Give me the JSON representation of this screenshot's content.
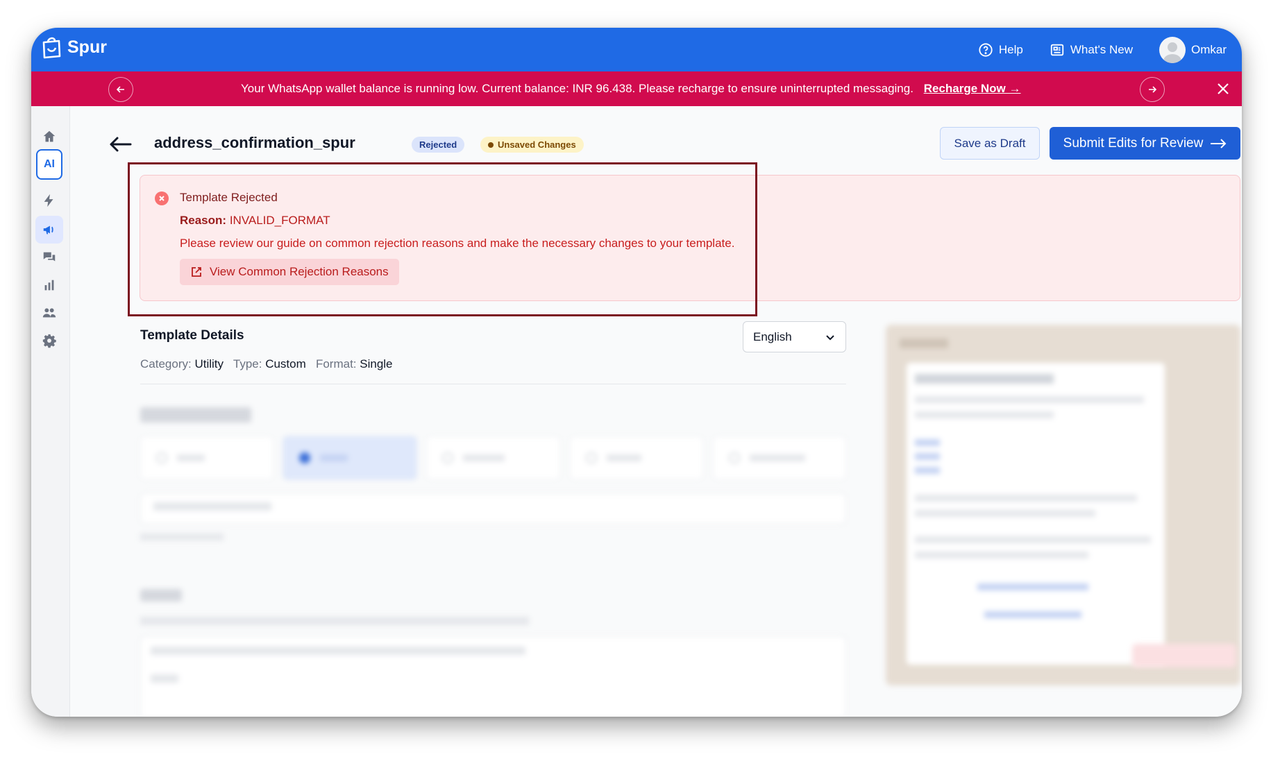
{
  "app": {
    "name": "Spur"
  },
  "topbar": {
    "help_label": "Help",
    "whats_new_label": "What's New",
    "user_name": "Omkar"
  },
  "banner": {
    "message": "Your WhatsApp wallet balance is running low. Current balance: INR 96.438. Please recharge to ensure uninterrupted messaging.",
    "link_label": "Recharge Now →"
  },
  "sidebar": {
    "items": [
      {
        "icon": "home-icon"
      },
      {
        "icon": "ai-icon",
        "label": "AI"
      },
      {
        "icon": "lightning-icon"
      },
      {
        "icon": "megaphone-icon"
      },
      {
        "icon": "chat-icon"
      },
      {
        "icon": "bar-chart-icon"
      },
      {
        "icon": "users-icon"
      },
      {
        "icon": "gear-icon"
      }
    ]
  },
  "header": {
    "title": "address_confirmation_spur",
    "status_badge": "Rejected",
    "unsaved_badge": "Unsaved Changes",
    "save_draft_label": "Save as Draft",
    "submit_label": "Submit Edits for Review"
  },
  "rejection": {
    "title": "Template Rejected",
    "reason_label": "Reason:",
    "reason_value": "INVALID_FORMAT",
    "description": "Please review our guide on common rejection reasons and make the necessary changes to your template.",
    "button_label": "View Common Rejection Reasons"
  },
  "details": {
    "title": "Template Details",
    "category_label": "Category:",
    "category_value": "Utility",
    "type_label": "Type:",
    "type_value": "Custom",
    "format_label": "Format:",
    "format_value": "Single",
    "language": "English"
  },
  "colors": {
    "topbar": "#1f6ae5",
    "banner": "#d10b4e",
    "primary_button": "#1f5fd6",
    "rejection_bg": "#fdeced",
    "highlight_border": "#7b1020"
  }
}
